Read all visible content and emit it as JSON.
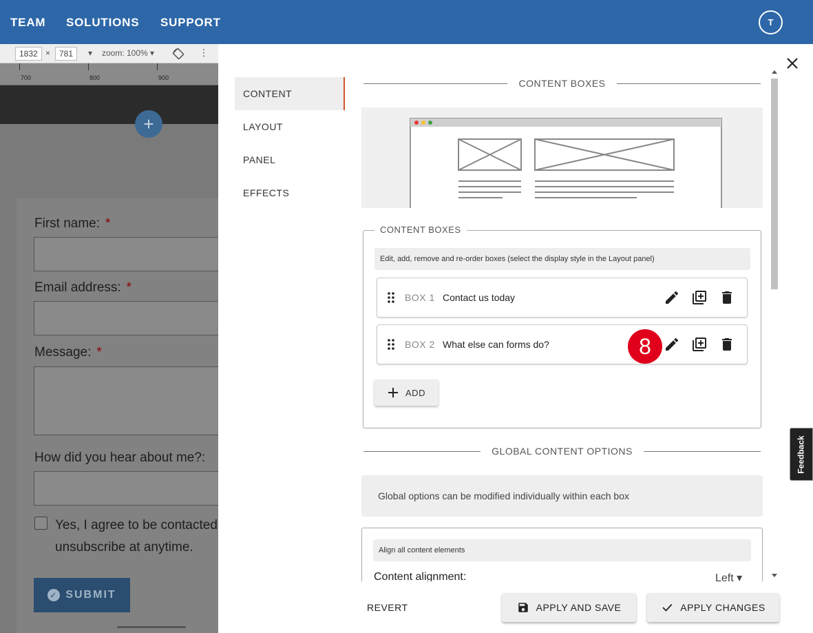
{
  "nav": {
    "links": [
      "TEAM",
      "SOLUTIONS",
      "SUPPORT"
    ],
    "avatar_initial": "T"
  },
  "editor_bg": {
    "width": "1832",
    "times": "×",
    "height": "781",
    "zoom": "zoom: 100%",
    "ruler_labels": [
      "700",
      "800",
      "900"
    ],
    "form": {
      "first_name": "First name:",
      "email": "Email address:",
      "message": "Message:",
      "hear": "How did you hear about me?:",
      "required": "*",
      "agree_line1": "Yes, I agree to be contacted",
      "agree_line2": "unsubscribe at anytime.",
      "submit": "SUBMIT"
    }
  },
  "dialog": {
    "tabs": [
      "CONTENT",
      "LAYOUT",
      "PANEL",
      "EFFECTS"
    ],
    "active_tab": "CONTENT",
    "section_title": "CONTENT BOXES",
    "fieldset_legend": "CONTENT BOXES",
    "hint": "Edit, add, remove and re-order boxes (select the display style in the Layout panel)",
    "boxes": [
      {
        "num": "BOX 1",
        "title": "Contact us today"
      },
      {
        "num": "BOX 2",
        "title": "What else can forms do?"
      }
    ],
    "badge": "8",
    "add_label": "ADD",
    "global_title": "GLOBAL CONTENT OPTIONS",
    "global_note": "Global options can be modified individually within each box",
    "align_hint": "Align all content elements",
    "content_alignment_label": "Content alignment:",
    "content_alignment_value": "Left",
    "revert": "REVERT",
    "apply_save": "APPLY AND SAVE",
    "apply_changes": "APPLY CHANGES"
  },
  "feedback": "Feedback",
  "colors": {
    "nav_bg": "#2d67a8",
    "active_tab_accent": "#d1552a",
    "badge": "#e0001b"
  }
}
